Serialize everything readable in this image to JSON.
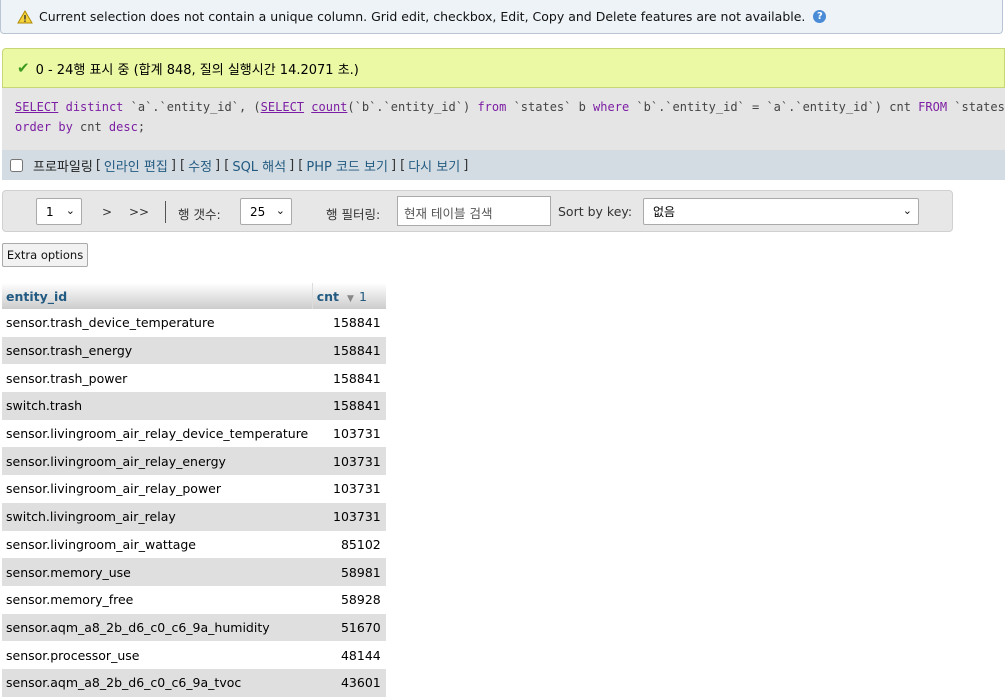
{
  "notice": {
    "text": "Current selection does not contain a unique column. Grid edit, checkbox, Edit, Copy and Delete features are not available."
  },
  "success": {
    "text": "0 - 24행 표시 중 (합계 848, 질의 실행시간 14.2071 초.)"
  },
  "sql": {
    "line1": "SELECT distinct `a`.`entity_id`, (SELECT count(`b`.`entity_id`) from `states` b where `b`.`entity_id` = `a`.`entity_id`) cnt FROM `states` a",
    "line2": "order by cnt desc;"
  },
  "profiling": {
    "label": "프로파일링",
    "links": [
      "인라인 편집",
      "수정",
      "SQL 해석",
      "PHP 코드 보기",
      "다시 보기"
    ]
  },
  "nav": {
    "page_value": "1",
    "next": ">",
    "last": ">>",
    "rows_label": "행 갯수:",
    "rows_value": "25",
    "filter_label": "행 필터링:",
    "filter_placeholder": "현재 테이블 검색",
    "sort_label": "Sort by key:",
    "sort_value": "없음"
  },
  "extra_options": "Extra options",
  "table": {
    "col_entity": "entity_id",
    "col_cnt": "cnt",
    "sort_order": "1",
    "rows": [
      {
        "entity_id": "sensor.trash_device_temperature",
        "cnt": "158841"
      },
      {
        "entity_id": "sensor.trash_energy",
        "cnt": "158841"
      },
      {
        "entity_id": "sensor.trash_power",
        "cnt": "158841"
      },
      {
        "entity_id": "switch.trash",
        "cnt": "158841"
      },
      {
        "entity_id": "sensor.livingroom_air_relay_device_temperature",
        "cnt": "103731"
      },
      {
        "entity_id": "sensor.livingroom_air_relay_energy",
        "cnt": "103731"
      },
      {
        "entity_id": "sensor.livingroom_air_relay_power",
        "cnt": "103731"
      },
      {
        "entity_id": "switch.livingroom_air_relay",
        "cnt": "103731"
      },
      {
        "entity_id": "sensor.livingroom_air_wattage",
        "cnt": "85102"
      },
      {
        "entity_id": "sensor.memory_use",
        "cnt": "58981"
      },
      {
        "entity_id": "sensor.memory_free",
        "cnt": "58928"
      },
      {
        "entity_id": "sensor.aqm_a8_2b_d6_c0_c6_9a_humidity",
        "cnt": "51670"
      },
      {
        "entity_id": "sensor.processor_use",
        "cnt": "48144"
      },
      {
        "entity_id": "sensor.aqm_a8_2b_d6_c0_c6_9a_tvoc",
        "cnt": "43601"
      }
    ]
  }
}
